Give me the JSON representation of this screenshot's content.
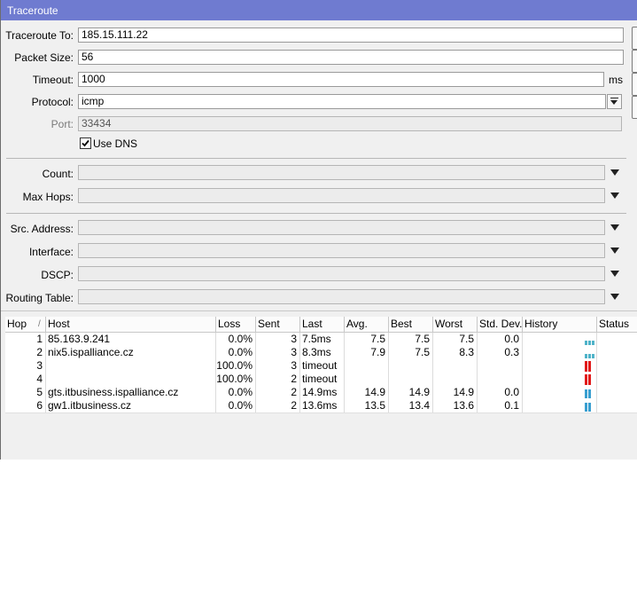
{
  "window": {
    "title": "Traceroute"
  },
  "form": {
    "traceroute_to": {
      "label": "Traceroute To:",
      "value": "185.15.111.22"
    },
    "packet_size": {
      "label": "Packet Size:",
      "value": "56"
    },
    "timeout": {
      "label": "Timeout:",
      "value": "1000",
      "unit": "ms"
    },
    "protocol": {
      "label": "Protocol:",
      "value": "icmp"
    },
    "port": {
      "label": "Port:",
      "value": "33434"
    },
    "use_dns": {
      "label": "Use DNS",
      "checked": true
    },
    "count": {
      "label": "Count:",
      "value": ""
    },
    "max_hops": {
      "label": "Max Hops:",
      "value": ""
    },
    "src_address": {
      "label": "Src. Address:",
      "value": ""
    },
    "interface": {
      "label": "Interface:",
      "value": ""
    },
    "dscp": {
      "label": "DSCP:",
      "value": ""
    },
    "routing_table": {
      "label": "Routing Table:",
      "value": ""
    }
  },
  "table": {
    "columns": [
      "Hop",
      "Host",
      "Loss",
      "Sent",
      "Last",
      "Avg.",
      "Best",
      "Worst",
      "Std. Dev.",
      "History",
      "Status"
    ],
    "sort_indicator": "/",
    "rows": [
      {
        "hop": "1",
        "host": "85.163.9.241",
        "loss": "0.0%",
        "sent": "3",
        "last": "7.5ms",
        "avg": "7.5",
        "best": "7.5",
        "worst": "7.5",
        "stddev": "0.0",
        "history": "ok-small"
      },
      {
        "hop": "2",
        "host": "nix5.ispalliance.cz",
        "loss": "0.0%",
        "sent": "3",
        "last": "8.3ms",
        "avg": "7.9",
        "best": "7.5",
        "worst": "8.3",
        "stddev": "0.3",
        "history": "ok-small"
      },
      {
        "hop": "3",
        "host": "",
        "loss": "100.0%",
        "sent": "3",
        "last": "timeout",
        "avg": "",
        "best": "",
        "worst": "",
        "stddev": "",
        "history": "timeout"
      },
      {
        "hop": "4",
        "host": "",
        "loss": "100.0%",
        "sent": "2",
        "last": "timeout",
        "avg": "",
        "best": "",
        "worst": "",
        "stddev": "",
        "history": "timeout"
      },
      {
        "hop": "5",
        "host": "gts.itbusiness.ispalliance.cz",
        "loss": "0.0%",
        "sent": "2",
        "last": "14.9ms",
        "avg": "14.9",
        "best": "14.9",
        "worst": "14.9",
        "stddev": "0.0",
        "history": "ok-tall"
      },
      {
        "hop": "6",
        "host": "gw1.itbusiness.cz",
        "loss": "0.0%",
        "sent": "2",
        "last": "13.6ms",
        "avg": "13.5",
        "best": "13.4",
        "worst": "13.6",
        "stddev": "0.1",
        "history": "ok-tall"
      }
    ]
  },
  "colors": {
    "title_bar": "#6f7bd0",
    "history_ok": "#4fb3c9",
    "history_ok_tall": "#3a9fd0",
    "history_timeout": "#e11b1b"
  }
}
